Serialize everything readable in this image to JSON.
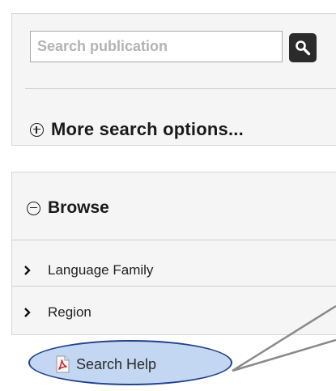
{
  "search": {
    "placeholder": "Search publication",
    "button_icon": "search-icon",
    "more_options_label": "More search options...",
    "more_options_icon": "plus-circle-icon"
  },
  "browse": {
    "title": "Browse",
    "title_icon": "minus-circle-icon",
    "items": [
      {
        "label": "Language Family",
        "icon": "chevron-right-icon"
      },
      {
        "label": "Region",
        "icon": "chevron-right-icon"
      }
    ]
  },
  "help": {
    "label": "Search Help",
    "icon": "pdf-icon",
    "highlight_color": "#c3d7f2",
    "highlight_border": "#23418a"
  },
  "colors": {
    "panel_background": "#f5f5f5",
    "panel_border": "#d6d6d6",
    "search_button": "#2b2b2b",
    "callout_line": "#8a8a8a"
  }
}
